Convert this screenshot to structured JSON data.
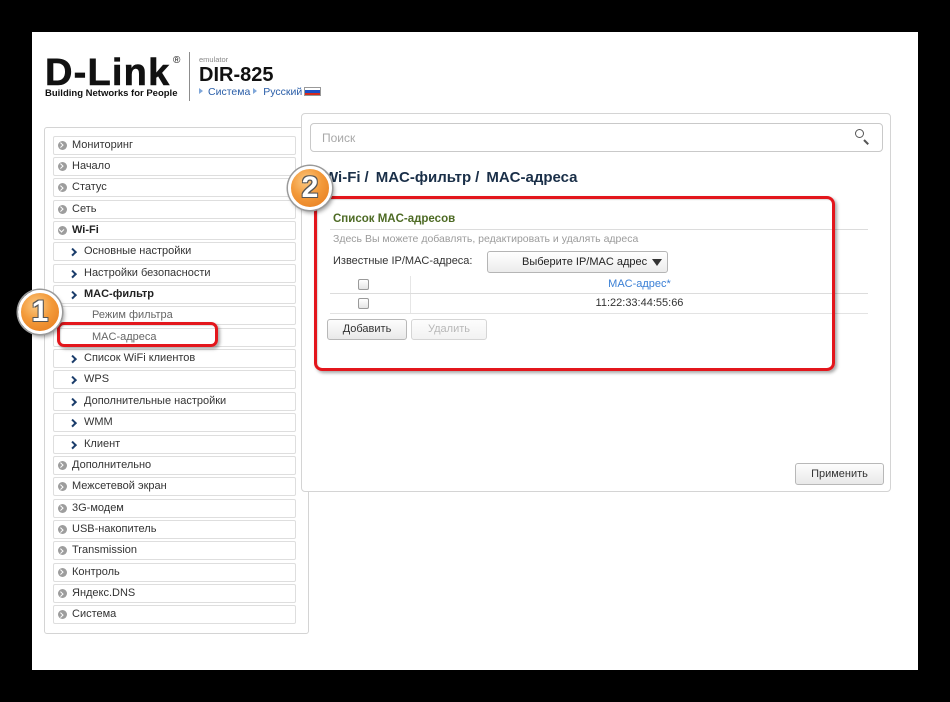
{
  "header": {
    "logo": "D-Link",
    "logo_mark": "®",
    "tagline": "Building Networks for People",
    "emulator": "emulator",
    "model": "DIR-825",
    "nav": {
      "system": "Система",
      "language": "Русский"
    }
  },
  "sidebar": {
    "items": [
      {
        "label": "Мониторинг",
        "icon": "circle-chevron-right-icon"
      },
      {
        "label": "Начало",
        "icon": "circle-chevron-right-icon"
      },
      {
        "label": "Статус",
        "icon": "circle-chevron-right-icon"
      },
      {
        "label": "Сеть",
        "icon": "circle-chevron-right-icon"
      },
      {
        "label": "Wi-Fi",
        "icon": "circle-chevron-down-icon"
      },
      {
        "label": "Основные настройки",
        "icon": "chevron-right-icon"
      },
      {
        "label": "Настройки безопасности",
        "icon": "chevron-right-icon"
      },
      {
        "label": "MAC-фильтр",
        "icon": "chevron-right-icon"
      },
      {
        "label": "Режим фильтра"
      },
      {
        "label": "MAC-адреса"
      },
      {
        "label": "Список WiFi клиентов",
        "icon": "chevron-right-icon"
      },
      {
        "label": "WPS",
        "icon": "chevron-right-icon"
      },
      {
        "label": "Дополнительные настройки",
        "icon": "chevron-right-icon"
      },
      {
        "label": "WMM",
        "icon": "chevron-right-icon"
      },
      {
        "label": "Клиент",
        "icon": "chevron-right-icon"
      },
      {
        "label": "Дополнительно",
        "icon": "circle-chevron-right-icon"
      },
      {
        "label": "Межсетевой экран",
        "icon": "circle-chevron-right-icon"
      },
      {
        "label": "3G-модем",
        "icon": "circle-chevron-right-icon"
      },
      {
        "label": "USB-накопитель",
        "icon": "circle-chevron-right-icon"
      },
      {
        "label": "Transmission",
        "icon": "circle-chevron-right-icon"
      },
      {
        "label": "Контроль",
        "icon": "circle-chevron-right-icon"
      },
      {
        "label": "Яндекс.DNS",
        "icon": "circle-chevron-right-icon"
      },
      {
        "label": "Система",
        "icon": "circle-chevron-right-icon"
      }
    ]
  },
  "search": {
    "placeholder": "Поиск",
    "icon": "search-icon"
  },
  "breadcrumb": {
    "items": [
      "Wi-Fi",
      "MAC-фильтр",
      "MAC-адреса"
    ],
    "separator": "/"
  },
  "mac_list": {
    "title": "Список MAC-адресов",
    "description": "Здесь Вы можете добавлять, редактировать и удалять адреса",
    "known_label": "Известные IP/MAC-адреса:",
    "select_value": "Выберите IP/MAC адрес",
    "column_header": "MAC-адрес*",
    "rows": [
      {
        "mac": "11:22:33:44:55:66",
        "checked": false
      }
    ],
    "add_label": "Добавить",
    "delete_label": "Удалить"
  },
  "footer": {
    "apply_label": "Применить"
  },
  "annotations": {
    "step1": "1",
    "step2": "2"
  },
  "colors": {
    "annotation_red": "#e3161c",
    "annotation_orange": "#f39a3a",
    "heading_green": "#4e6b25",
    "link_blue": "#2a5ea8",
    "column_header_blue": "#3a7fd5",
    "breadcrumb_navy": "#1a2f48"
  }
}
